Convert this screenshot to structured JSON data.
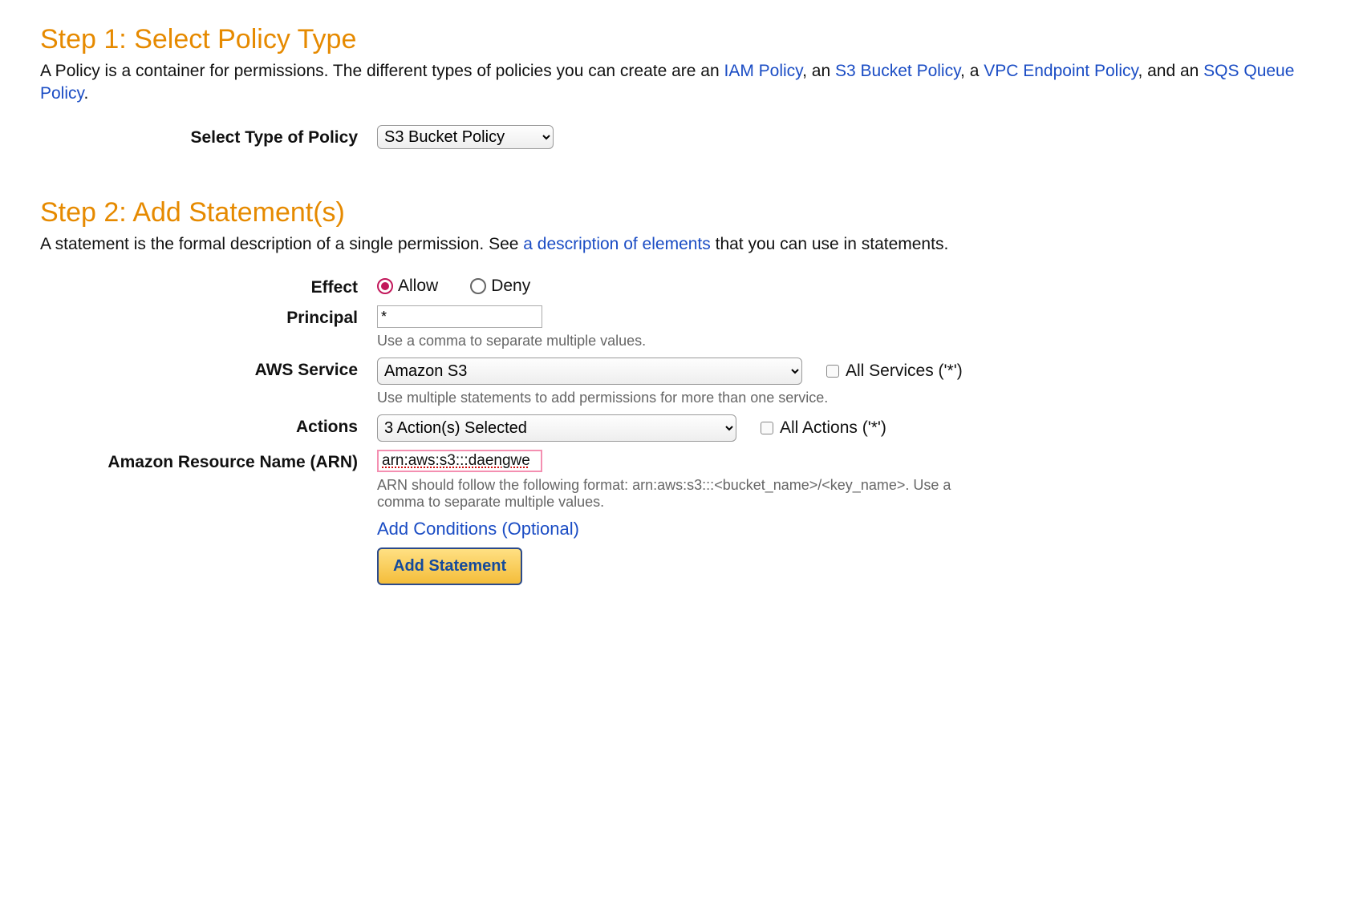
{
  "step1": {
    "title": "Step 1: Select Policy Type",
    "desc_prefix": "A Policy is a container for permissions. The different types of policies you can create are an ",
    "link_iam": "IAM Policy",
    "sep1": ", an ",
    "link_s3": "S3 Bucket Policy",
    "sep2": ", a ",
    "link_vpc": "VPC Endpoint Policy",
    "sep3": ", and an ",
    "link_sqs": "SQS Queue Policy",
    "desc_suffix": ".",
    "select_label": "Select Type of Policy",
    "select_value": "S3 Bucket Policy"
  },
  "step2": {
    "title": "Step 2: Add Statement(s)",
    "desc_prefix": "A statement is the formal description of a single permission. See ",
    "link_elements": "a description of elements",
    "desc_suffix": " that you can use in statements."
  },
  "effect": {
    "label": "Effect",
    "allow": "Allow",
    "deny": "Deny",
    "selected": "allow"
  },
  "principal": {
    "label": "Principal",
    "value": "*",
    "hint": "Use a comma to separate multiple values."
  },
  "service": {
    "label": "AWS Service",
    "value": "Amazon S3",
    "all_label": "All Services ('*')",
    "hint": "Use multiple statements to add permissions for more than one service."
  },
  "actions": {
    "label": "Actions",
    "value": "3 Action(s) Selected",
    "all_label": "All Actions ('*')"
  },
  "arn": {
    "label": "Amazon Resource Name (ARN)",
    "value": "arn:aws:s3:::daengwe",
    "hint": "ARN should follow the following format: arn:aws:s3:::<bucket_name>/<key_name>. Use a comma to separate multiple values."
  },
  "conditions": {
    "link": "Add Conditions (Optional)"
  },
  "buttons": {
    "add_statement": "Add Statement"
  }
}
